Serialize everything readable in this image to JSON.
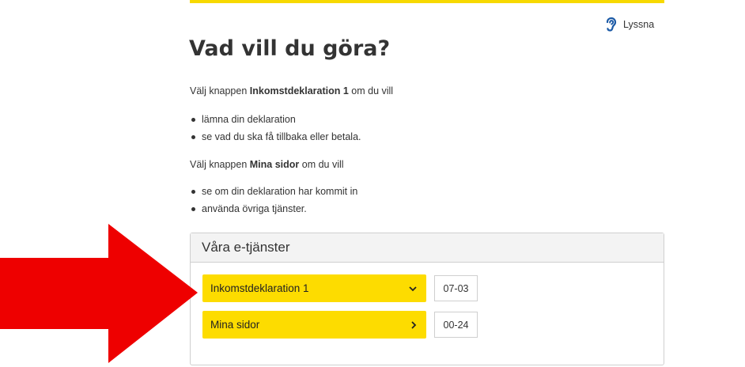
{
  "header": {
    "listen_label": "Lyssna"
  },
  "main": {
    "title": "Vad vill du göra?",
    "intro1": {
      "prefix": "Välj knappen ",
      "bold": "Inkomstdeklaration 1",
      "suffix": " om du vill"
    },
    "list1": [
      "lämna din deklaration",
      "se vad du ska få tillbaka eller betala."
    ],
    "intro2": {
      "prefix": "Välj knappen ",
      "bold": "Mina sidor",
      "suffix": " om du vill"
    },
    "list2": [
      "se om din deklaration har kommit in",
      "använda övriga tjänster."
    ]
  },
  "services": {
    "heading": "Våra e-tjänster",
    "items": [
      {
        "label": "Inkomstdeklaration 1",
        "hours": "07-03",
        "icon": "chevron-down-icon"
      },
      {
        "label": "Mina sidor",
        "hours": "00-24",
        "icon": "chevron-right-icon"
      }
    ]
  },
  "colors": {
    "accent_yellow": "#fddc00",
    "arrow_red": "#ee0000",
    "text": "#333333"
  }
}
